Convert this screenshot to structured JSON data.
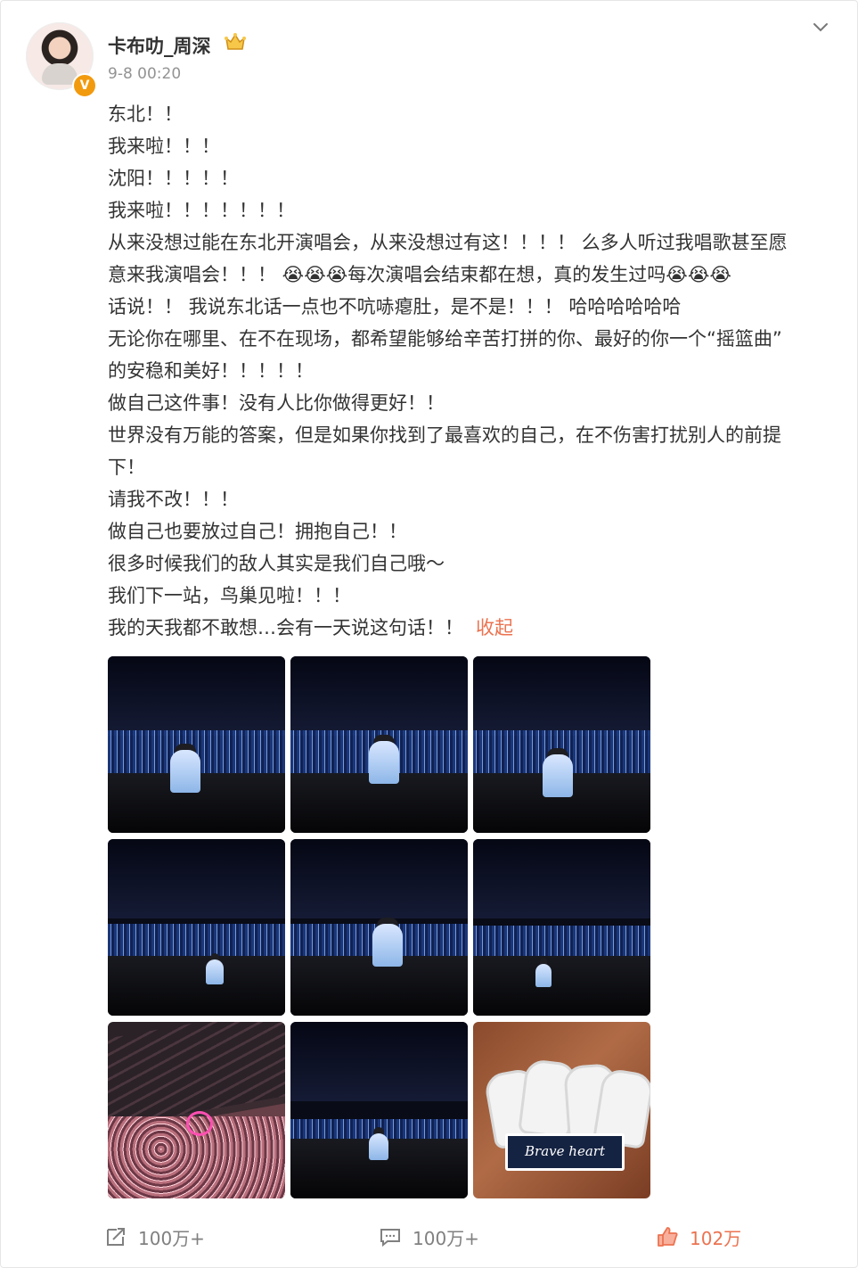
{
  "post": {
    "author_name": "卡布叻_周深",
    "time": "9-8 00:20",
    "verified_badge": "V",
    "content_lines": [
      "东北！！",
      "我来啦！！！",
      "沈阳！！！！！",
      "我来啦！！！！！！！",
      "从来没想过能在东北开演唱会，从来没想过有这！！！！ 么多人听过我唱歌甚至愿",
      "意来我演唱会！！！ 😭😭😭每次演唱会结束都在想，真的发生过吗😭😭😭",
      "话说！！ 我说东北话一点也不吭哧瘪肚，是不是！！！ 哈哈哈哈哈哈",
      "无论你在哪里、在不在现场，都希望能够给辛苦打拼的你、最好的你一个“摇篮曲”",
      "的安稳和美好！！！！！",
      "做自己这件事！没有人比你做得更好！！",
      "世界没有万能的答案，但是如果你找到了最喜欢的自己，在不伤害打扰别人的前提",
      "下！",
      "请我不改！！！",
      "做自己也要放过自己！拥抱自己！！",
      "很多时候我们的敌人其实是我们自己哦～",
      "我们下一站，鸟巢见啦！！！",
      "我的天我都不敢想…会有一天说这句话！！"
    ],
    "collapse_label": "收起",
    "photo_tag_text": "Brave heart",
    "actions": {
      "share_count": "100万+",
      "comment_count": "100万+",
      "like_count": "102万"
    }
  },
  "colors": {
    "accent": "#eb7350",
    "verified_badge": "#f29a0e",
    "muted_text": "#939393"
  }
}
